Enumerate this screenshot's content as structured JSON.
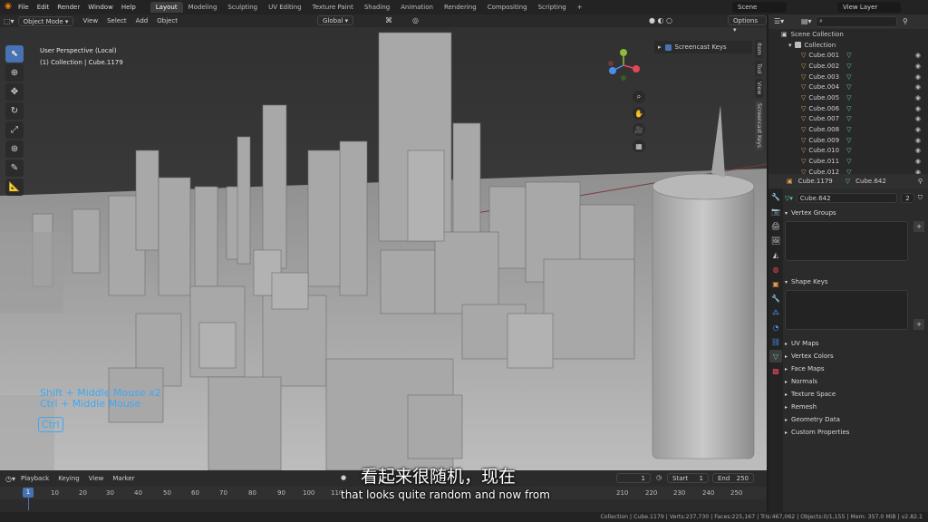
{
  "topbar": {
    "menus": [
      "File",
      "Edit",
      "Render",
      "Window",
      "Help"
    ],
    "workspaces": [
      "Layout",
      "Modeling",
      "Sculpting",
      "UV Editing",
      "Texture Paint",
      "Shading",
      "Animation",
      "Rendering",
      "Compositing",
      "Scripting",
      "+"
    ],
    "active_workspace": "Layout",
    "scene": "Scene",
    "view_layer": "View Layer"
  },
  "viewport_header": {
    "mode": "Object Mode",
    "menus": [
      "View",
      "Select",
      "Add",
      "Object"
    ],
    "orientation": "Global",
    "options": "Options"
  },
  "viewport": {
    "perspective": "User Perspective (Local)",
    "collection_info": "(1) Collection | Cube.1179",
    "screencast_keys_label": "Screencast Keys",
    "key_line1": "Shift + Middle Mouse x2",
    "key_line2": "Ctrl + Middle Mouse",
    "key_badge": "Ctrl",
    "side_tabs": [
      "Item",
      "Tool",
      "View",
      "Screencast Keys"
    ]
  },
  "outliner": {
    "root": "Scene Collection",
    "collection": "Collection",
    "items": [
      "Cube.001",
      "Cube.002",
      "Cube.003",
      "Cube.004",
      "Cube.005",
      "Cube.006",
      "Cube.007",
      "Cube.008",
      "Cube.009",
      "Cube.010",
      "Cube.011",
      "Cube.012"
    ]
  },
  "properties": {
    "object_name": "Cube.1179",
    "mesh_name": "Cube.642",
    "datablock": "Cube.642",
    "users": "2",
    "sections_open": [
      "Vertex Groups",
      "Shape Keys"
    ],
    "sections_closed": [
      "UV Maps",
      "Vertex Colors",
      "Face Maps",
      "Normals",
      "Texture Space",
      "Remesh",
      "Geometry Data",
      "Custom Properties"
    ]
  },
  "timeline": {
    "menus": [
      "Playback",
      "Keying",
      "View",
      "Marker"
    ],
    "current_frame": "1",
    "start_label": "Start",
    "start": "1",
    "end_label": "End",
    "end": "250",
    "ticks": [
      "1",
      "10",
      "20",
      "30",
      "40",
      "50",
      "60",
      "70",
      "80",
      "90",
      "100",
      "110",
      "210",
      "220",
      "230",
      "240",
      "250"
    ]
  },
  "subtitles": {
    "zh": "看起来很随机，现在",
    "en": "that looks quite random and now from"
  },
  "statusbar": {
    "text": "Collection | Cube.1179 | Verts:237,730 | Faces:225,167 | Tris:467,062 | Objects:0/1,155 | Mem: 357.0 MiB | v2.82.1"
  },
  "colors": {
    "accent": "#4772b3",
    "keys_overlay": "#3fa9f5",
    "object_icon": "#e59e4d",
    "mesh_icon": "#58d1b8"
  }
}
